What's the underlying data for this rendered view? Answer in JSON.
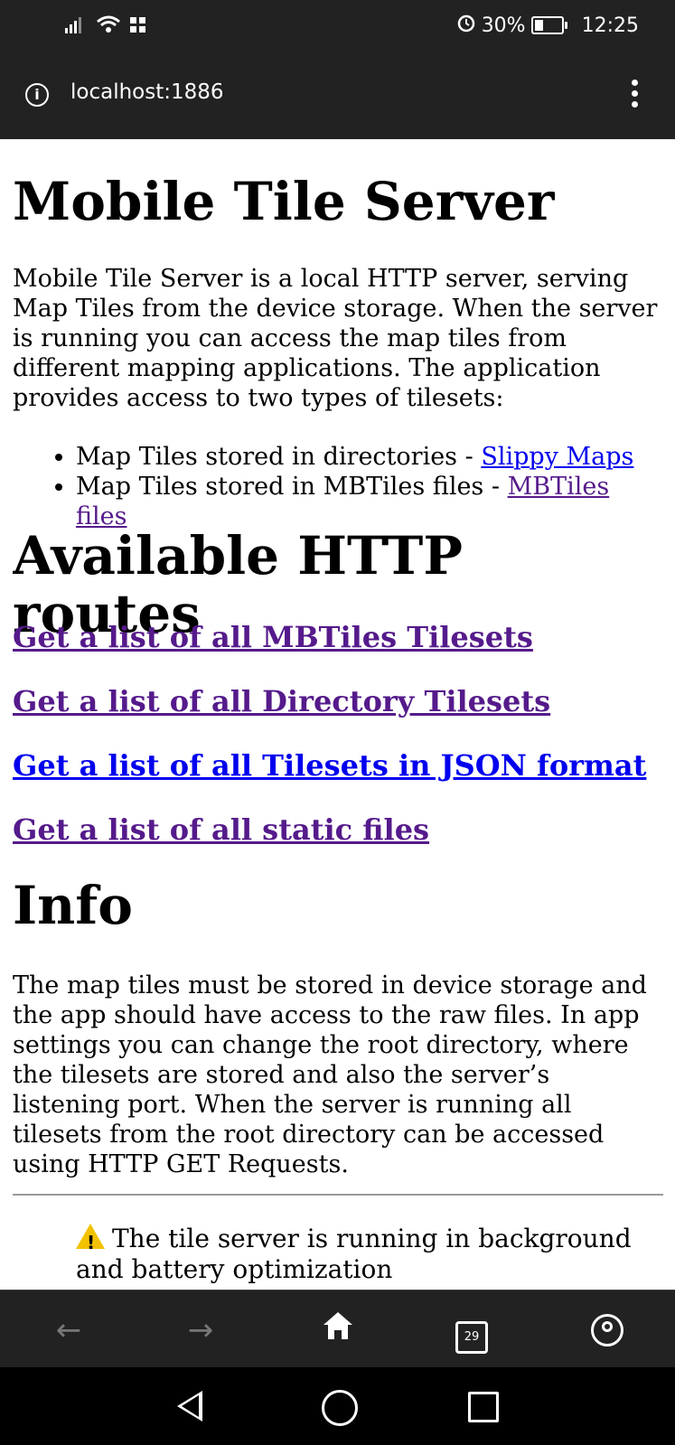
{
  "status_bar": {
    "battery_percent": "30%",
    "battery_level": 0.3,
    "time": "12:25"
  },
  "address_bar": {
    "url": "localhost:1886"
  },
  "page": {
    "title": "Mobile Tile Server",
    "intro": "Mobile Tile Server is a local HTTP server, serving Map Tiles from the device storage. When the server is running you can access the map tiles from different mapping applications. The application provides access to two types of tilesets:",
    "tileset_types": [
      {
        "text": "Map Tiles stored in directories - ",
        "link": "Slippy Maps"
      },
      {
        "text": "Map Tiles stored in MBTiles files - ",
        "link": "MBTiles files"
      }
    ],
    "routes_heading": "Available HTTP routes",
    "routes": [
      "Get a list of all MBTiles Tilesets",
      "Get a list of all Directory Tilesets",
      "Get a list of all Tilesets in JSON format",
      "Get a list of all static files"
    ],
    "info_heading": "Info",
    "info_text": "The map tiles must be stored in device storage and the app should have access to the raw files. In app settings you can change the root directory, where the tilesets are stored and also the server’s listening port. When the server is running all tilesets from the root directory can be accessed using HTTP GET Requests.",
    "warning_text": "The tile server is running in background and battery optimization"
  },
  "browser_toolbar": {
    "tab_count": "29"
  },
  "colors": {
    "chrome_bg": "#222222",
    "visited_link": "#551a8b",
    "link": "#0000ee"
  }
}
